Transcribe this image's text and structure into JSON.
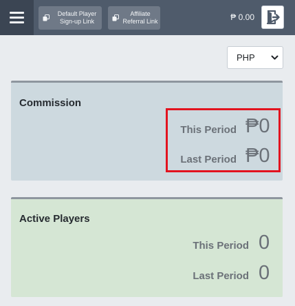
{
  "header": {
    "default_player_link_label": "Default Player Sign-up Link",
    "affiliate_referral_link_label": "Affiliate Referral Link",
    "balance": "₱ 0.00",
    "icons": {
      "menu": "hamburger-menu-icon",
      "copy": "copy-icon",
      "logout": "logout-icon"
    }
  },
  "currency_select": {
    "selected": "PHP"
  },
  "commission": {
    "title": "Commission",
    "rows": [
      {
        "label": "This Period",
        "value": "₱0"
      },
      {
        "label": "Last Period",
        "value": "₱0"
      }
    ]
  },
  "active_players": {
    "title": "Active Players",
    "rows": [
      {
        "label": "This Period",
        "value": "0"
      },
      {
        "label": "Last Period",
        "value": "0"
      }
    ]
  },
  "colors": {
    "topbar": "#4f5b6b",
    "commission_card": "#cdd9df",
    "players_card": "#d5e6d4",
    "highlight": "#e2131f"
  }
}
